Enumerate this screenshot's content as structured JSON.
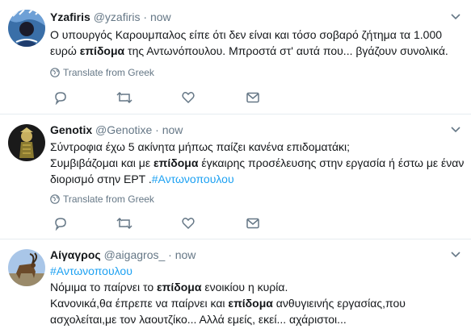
{
  "tweets": [
    {
      "name": "Yzafiris",
      "handle": "@yzafiris",
      "separator": "·",
      "time": "now",
      "text_parts": [
        {
          "t": "Ο υπουργός Καρουμπαλος είπε ότι δεν είναι και τόσο σοβαρό ζήτημα τα 1.000 ευρώ ",
          "b": false
        },
        {
          "t": "επίδομα",
          "b": true
        },
        {
          "t": " της Αντωνόπουλου. Μπροστά στ' αυτά που... βγάζουν συνολικά.",
          "b": false
        }
      ],
      "translate": "Translate from Greek"
    },
    {
      "name": "Genotix",
      "handle": "@Genotixe",
      "separator": "·",
      "time": "now",
      "text_parts": [
        {
          "t": "Σύντροφια έχω 5 ακίνητα μήπως παίζει κανένα επιδοματάκι;",
          "b": false
        },
        {
          "t": "Συμβιβάζομαι και με ",
          "b": false
        },
        {
          "t": "επίδομα",
          "b": true
        },
        {
          "t": " έγκαιρης προσέλευσης στην εργασία ή έστω με έναν διορισμό στην ΕΡΤ .",
          "b": false
        },
        {
          "t": "#Αντωνοπουλου",
          "b": false
        }
      ],
      "translate": "Translate from Greek"
    },
    {
      "name": "Αίγαγρος",
      "handle": "@aigagros_",
      "separator": "·",
      "time": "now",
      "hashtag": "#Αντωνοπουλου",
      "line1_pre": "Νόμιμα το παίρνει το ",
      "line1_bold": "επίδομα",
      "line1_post": " ενοικίου η κυρία.",
      "line2_pre": "Κανονικά,θα έπρεπε να παίρνει και ",
      "line2_bold": "επίδομα",
      "line2_post": " ανθυγιεινής εργασίας,που",
      "line3": "ασχολείται,με τον λαουτζίκο... Αλλά εμείς, εκεί... αχάριστοι..."
    }
  ],
  "colors": {
    "accent": "#1da1f2",
    "muted": "#657786",
    "text": "#14171a",
    "divider": "#e6ecf0"
  },
  "icons": [
    "globe-icon",
    "reply-icon",
    "retweet-icon",
    "like-icon",
    "message-icon",
    "chevron-down-icon"
  ]
}
